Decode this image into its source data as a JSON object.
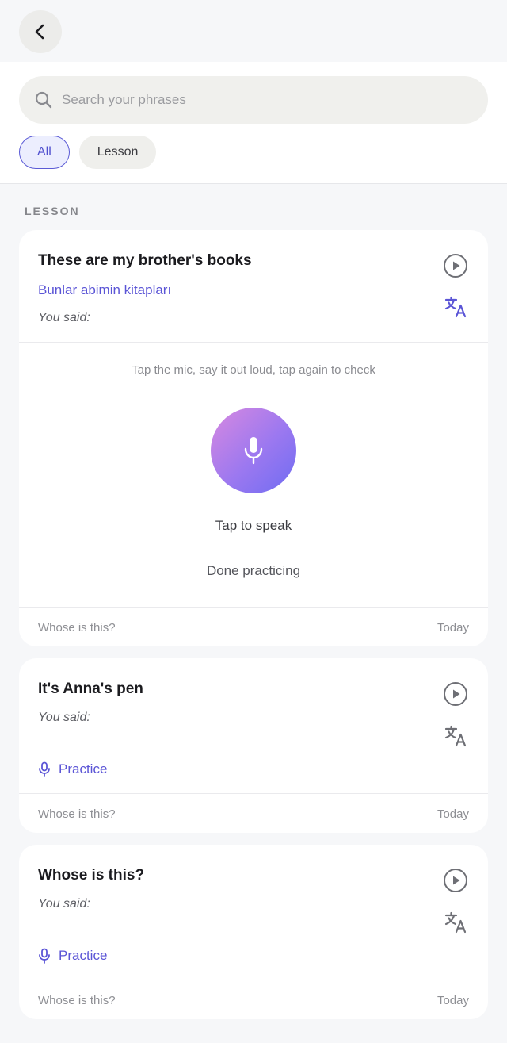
{
  "search": {
    "placeholder": "Search your phrases"
  },
  "filters": [
    {
      "label": "All",
      "active": true
    },
    {
      "label": "Lesson",
      "active": false
    }
  ],
  "section_label": "LESSON",
  "cards": [
    {
      "title": "These are my brother's books",
      "translation": "Bunlar abimin kitapları",
      "you_said": "You said:",
      "practice_hint": "Tap the mic, say it out loud, tap again to check",
      "mic_label": "Tap to speak",
      "done_label": "Done practicing",
      "footer_lesson": "Whose is this?",
      "footer_date": "Today"
    },
    {
      "title": "It's Anna's pen",
      "you_said": "You said:",
      "practice_label": "Practice",
      "footer_lesson": "Whose is this?",
      "footer_date": "Today"
    },
    {
      "title": "Whose is this?",
      "you_said": "You said:",
      "practice_label": "Practice",
      "footer_lesson": "Whose is this?",
      "footer_date": "Today"
    }
  ],
  "colors": {
    "accent": "#5b55d6",
    "background": "#f6f7f9",
    "icon_gray": "#6e6f75"
  },
  "icons": {
    "back": "chevron-left-icon",
    "search": "search-icon",
    "play": "play-circle-icon",
    "translate": "translate-icon",
    "mic": "microphone-icon"
  }
}
